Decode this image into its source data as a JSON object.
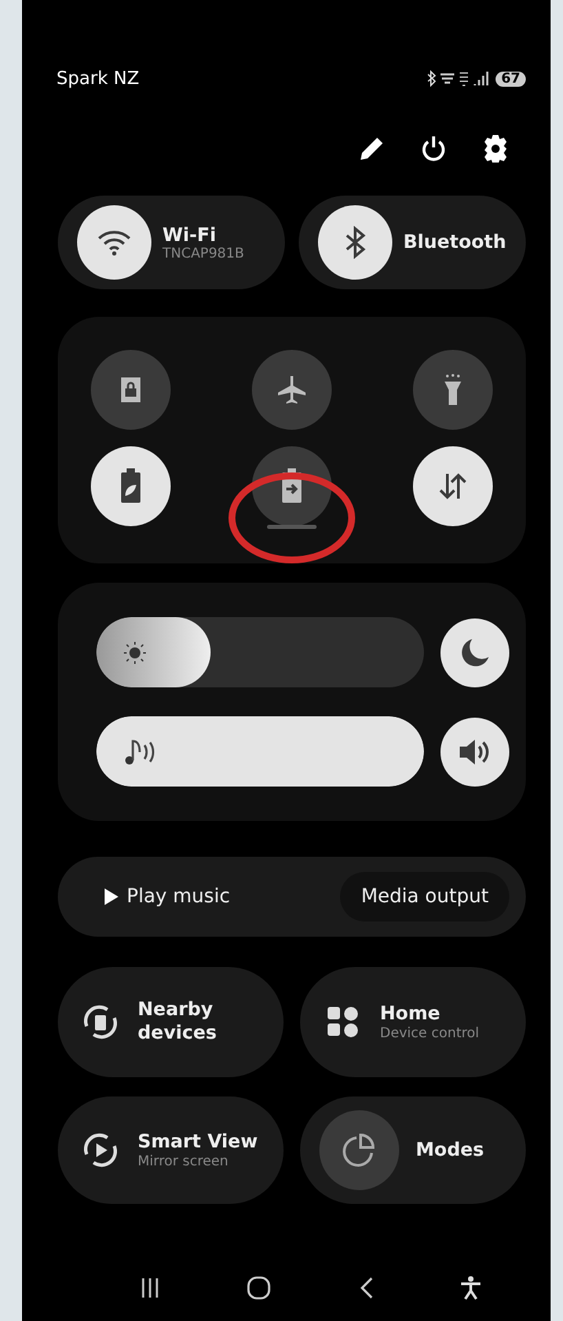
{
  "status_bar": {
    "carrier": "Spark NZ",
    "battery": "67"
  },
  "top_tiles": [
    {
      "kind": "wifi",
      "title": "Wi-Fi",
      "subtitle": "TNCAP981B",
      "on": true
    },
    {
      "kind": "bluetooth",
      "title": "Bluetooth",
      "on": true
    }
  ],
  "quick_toggles": [
    {
      "kind": "lock",
      "on": false
    },
    {
      "kind": "airplane",
      "on": false
    },
    {
      "kind": "flashlight",
      "on": false
    },
    {
      "kind": "power-saving",
      "on": true
    },
    {
      "kind": "battery-share",
      "on": false
    },
    {
      "kind": "data",
      "on": true
    }
  ],
  "sliders": [
    {
      "kind": "brightness",
      "level": 0.35,
      "button_on": true
    },
    {
      "kind": "volume",
      "level": 1.0,
      "button_on": true
    }
  ],
  "media": {
    "play": "Play music",
    "output": "Media output"
  },
  "tiles": [
    {
      "kind": "nearby",
      "title": "Nearby devices",
      "on": false
    },
    {
      "kind": "home",
      "title": "Home",
      "subtitle": "Device control",
      "on": false
    },
    {
      "kind": "smartview",
      "title": "Smart View",
      "subtitle": "Mirror screen",
      "on": false
    },
    {
      "kind": "modes",
      "title": "Modes",
      "on": true
    }
  ]
}
